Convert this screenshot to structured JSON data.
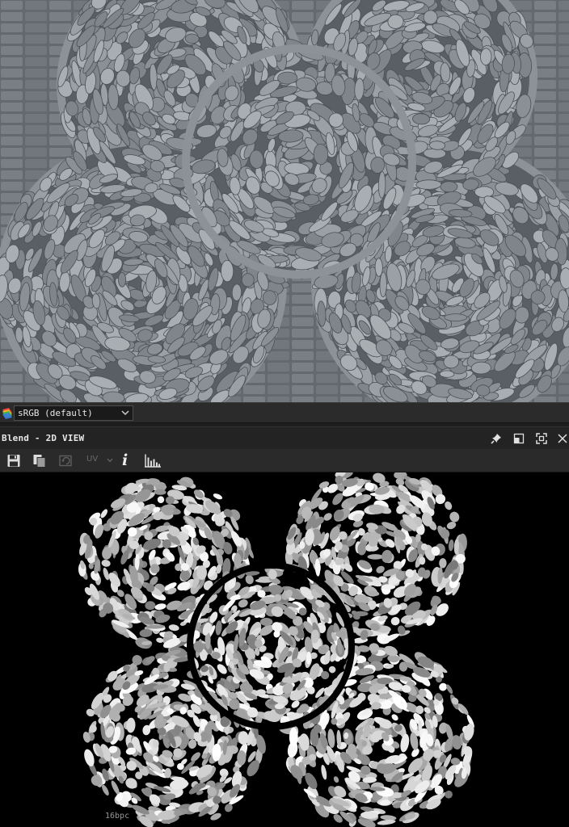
{
  "colorspace": {
    "selected": "sRGB (default)",
    "icon": "color-profile-icon"
  },
  "panel2d": {
    "title": "Blend - 2D VIEW",
    "header_icons": [
      "pin-icon",
      "float-window-icon",
      "maximize-icon",
      "close-icon"
    ]
  },
  "toolbar": {
    "icons": [
      "save-icon",
      "copy-icon",
      "refresh-icon",
      "info-icon",
      "histogram-icon"
    ],
    "uv_label": "UV",
    "info_label": "i"
  },
  "view2d": {
    "bit_depth": "16bpc"
  }
}
